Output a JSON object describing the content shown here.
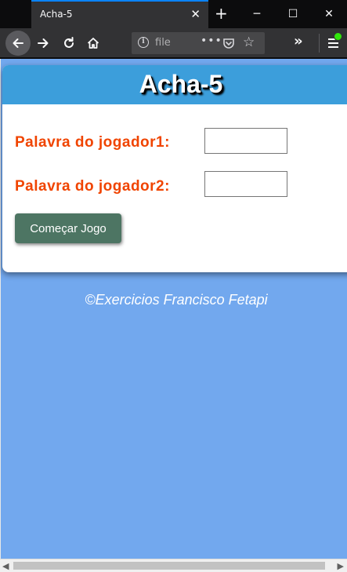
{
  "browser": {
    "tab_title": "Acha-5",
    "tab_close_glyph": "✕",
    "new_tab_glyph": "+",
    "window_controls": {
      "minimize": "─",
      "maximize": "☐",
      "close": "✕"
    },
    "url_text": "file",
    "url_dots": "•••",
    "overflow_glyph": "»",
    "icons": [
      "back-arrow-icon",
      "forward-arrow-icon",
      "reload-icon",
      "home-icon",
      "info-icon",
      "pocket-icon",
      "star-icon",
      "menu-icon"
    ]
  },
  "page": {
    "title": "Acha-5",
    "player1_label": "Palavra do jogador1:",
    "player1_value": "",
    "player2_label": "Palavra do jogador2:",
    "player2_value": "",
    "start_button": "Começar Jogo",
    "footer": "©Exercicios Francisco Fetapi"
  },
  "colors": {
    "page_bg": "#72a8ee",
    "header_bg": "#3c9edb",
    "label_color": "#f04400",
    "button_bg": "#4d7563"
  }
}
